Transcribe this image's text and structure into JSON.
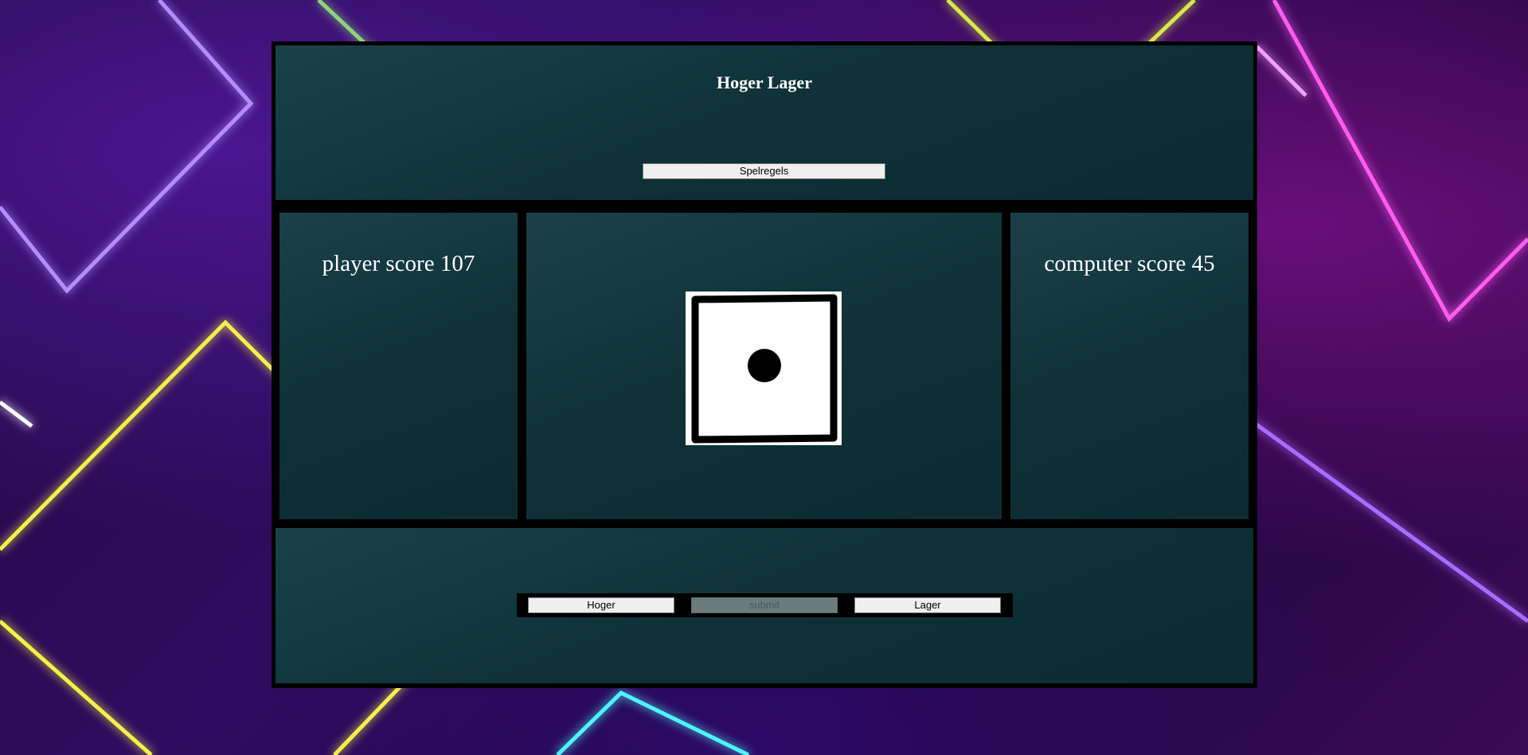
{
  "app": {
    "title": "Hoger Lager"
  },
  "header": {
    "rules_button": "Spelregels"
  },
  "scores": {
    "player": "player score 107",
    "computer": "computer score 45"
  },
  "die": {
    "value": 1,
    "icon": "die-one-icon"
  },
  "controls": {
    "higher_label": "Hoger",
    "submit_label": "submit",
    "lower_label": "Lager"
  },
  "colors": {
    "panel": "#0e343a",
    "frame": "#000000",
    "text": "#ffffff"
  }
}
